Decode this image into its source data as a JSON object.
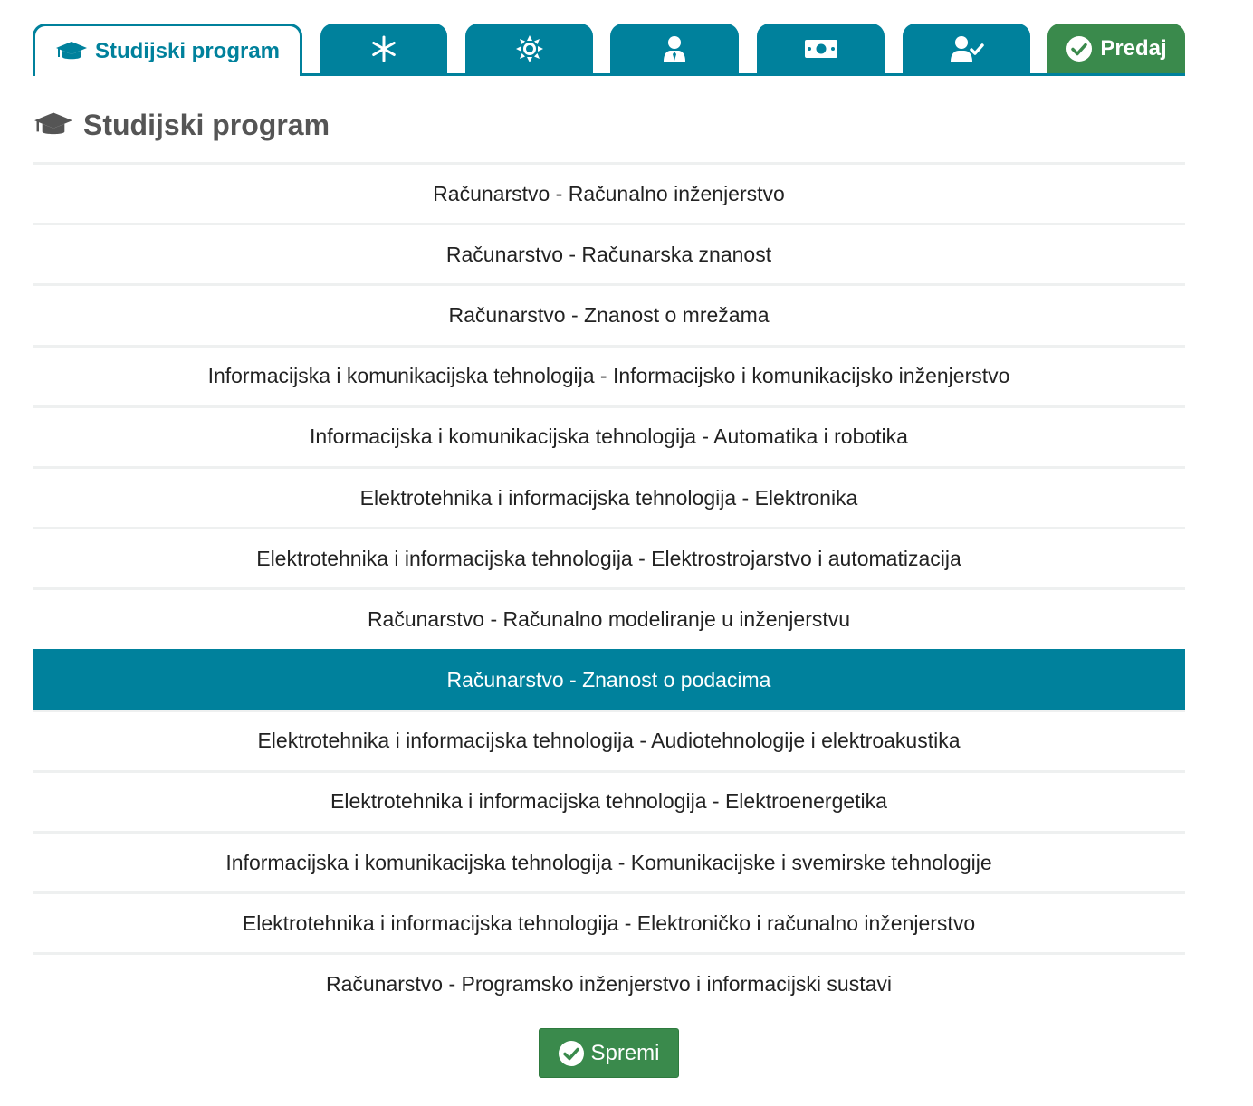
{
  "tabs": {
    "active_label": "Studijski program",
    "icons": [
      "graduation-cap-icon",
      "snowflake-icon",
      "sun-icon",
      "user-tie-icon",
      "money-bill-icon",
      "user-check-icon",
      "check-circle-icon"
    ],
    "submit_label": "Predaj"
  },
  "heading": {
    "title": "Studijski program"
  },
  "programs": [
    "Računarstvo - Računalno inženjerstvo",
    "Računarstvo - Računarska znanost",
    "Računarstvo - Znanost o mrežama",
    "Informacijska i komunikacijska tehnologija - Informacijsko i komunikacijsko inženjerstvo",
    "Informacijska i komunikacijska tehnologija - Automatika i robotika",
    "Elektrotehnika i informacijska tehnologija - Elektronika",
    "Elektrotehnika i informacijska tehnologija - Elektrostrojarstvo i automatizacija",
    "Računarstvo - Računalno modeliranje u inženjerstvu",
    "Računarstvo - Znanost o podacima",
    "Elektrotehnika i informacijska tehnologija - Audiotehnologije i elektroakustika",
    "Elektrotehnika i informacijska tehnologija - Elektroenergetika",
    "Informacijska i komunikacijska tehnologija - Komunikacijske i svemirske tehnologije",
    "Elektrotehnika i informacijska tehnologija - Elektroničko i računalno inženjerstvo",
    "Računarstvo - Programsko inženjerstvo i informacijski sustavi"
  ],
  "selected_program": "Računarstvo - Znanost o podacima",
  "save_label": "Spremi",
  "colors": {
    "accent": "#00819c",
    "success": "#3a8a4c"
  }
}
